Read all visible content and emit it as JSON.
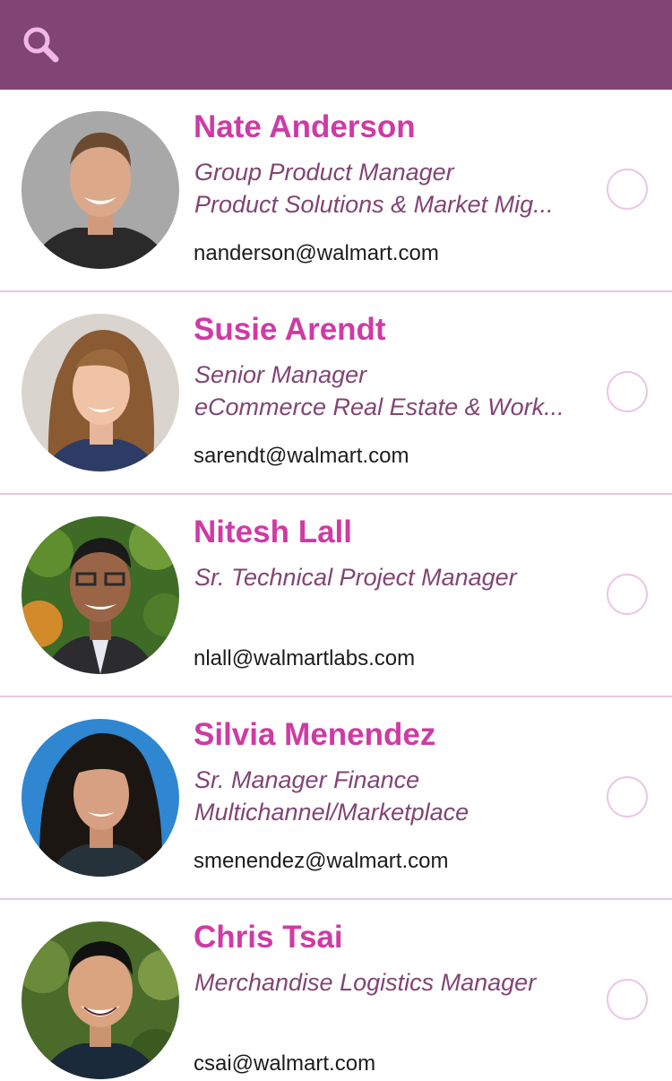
{
  "header": {
    "search_icon": "search-icon",
    "bar_color": "#824474"
  },
  "colors": {
    "name": "#cf3aa5",
    "title": "#824474",
    "divider": "#e9c6e3",
    "radio_border": "#ecc5e6"
  },
  "contacts": [
    {
      "name": "Nate Anderson",
      "title_line1": "Group Product Manager",
      "title_line2": "Product Solutions & Market Mig...",
      "email": "nanderson@walmart.com",
      "selected": false
    },
    {
      "name": "Susie Arendt",
      "title_line1": "Senior Manager",
      "title_line2": "eCommerce Real Estate & Work...",
      "email": "sarendt@walmart.com",
      "selected": false
    },
    {
      "name": "Nitesh Lall",
      "title_line1": "Sr. Technical Project Manager",
      "title_line2": "",
      "email": "nlall@walmartlabs.com",
      "selected": false
    },
    {
      "name": "Silvia Menendez",
      "title_line1": "Sr. Manager Finance",
      "title_line2": "Multichannel/Marketplace",
      "email": "smenendez@walmart.com",
      "selected": false
    },
    {
      "name": "Chris Tsai",
      "title_line1": "Merchandise Logistics Manager",
      "title_line2": "",
      "email": "csai@walmart.com",
      "selected": false
    }
  ]
}
